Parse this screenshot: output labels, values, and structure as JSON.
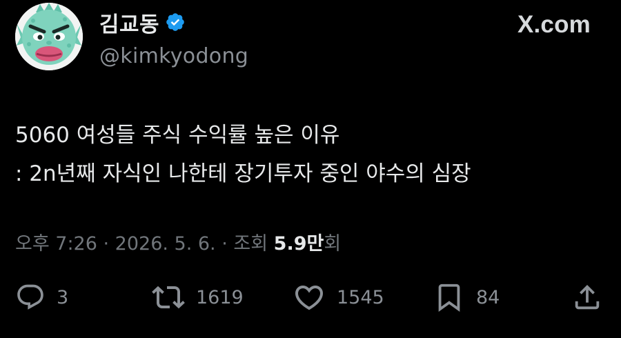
{
  "site_label": "X.com",
  "author": {
    "display_name": "김교동",
    "handle": "@kimkyodong",
    "verified": true
  },
  "tweet": {
    "lines": [
      "5060 여성들 주식 수익률 높은 이유",
      ": 2n년째 자식인 나한테 장기투자 중인 야수의 심장"
    ]
  },
  "meta": {
    "time": "오후 7:26",
    "separator": " · ",
    "date": "2026. 5. 6.",
    "views_prefix": "조회 ",
    "views_count": "5.9만",
    "views_suffix": "회"
  },
  "actions": {
    "replies": "3",
    "reposts": "1619",
    "likes": "1545",
    "bookmarks": "84"
  },
  "colors": {
    "background": "#000000",
    "text": "#e7e9ea",
    "muted": "#71767b",
    "verified": "#1d9bf0",
    "avatar_green": "#7fd3bd"
  },
  "icons": {
    "reply": "reply-icon",
    "repost": "repost-icon",
    "like": "heart-icon",
    "bookmark": "bookmark-icon",
    "share": "share-icon",
    "verified": "verified-badge-icon"
  }
}
